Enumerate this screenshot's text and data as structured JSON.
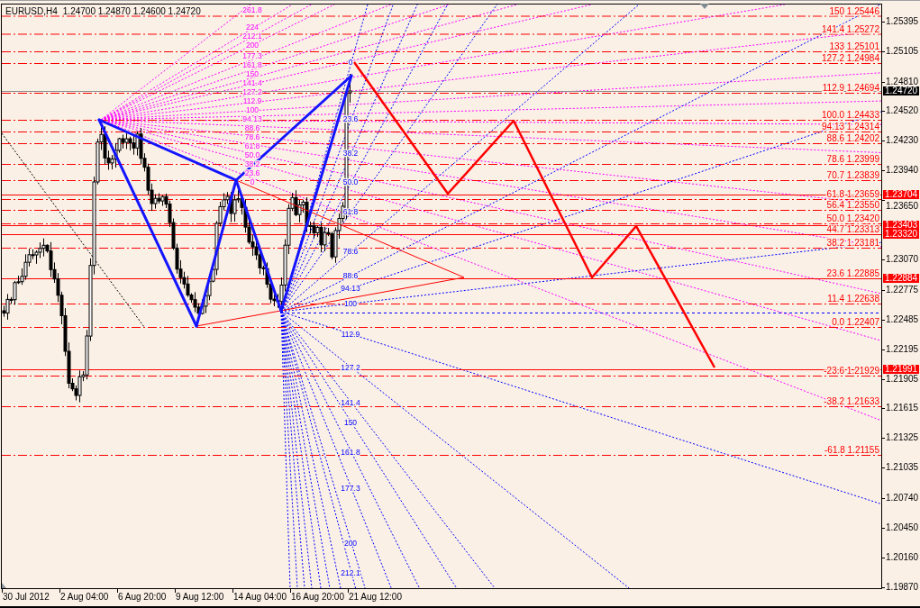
{
  "chart": {
    "symbol": "EURUSD,H4",
    "ohlc": "1.24700 1.24870 1.24600 1.24720"
  },
  "fib_levels": [
    "150 1.25446",
    "141.4 1.25272",
    "133 1.25101",
    "127.2 1.24984",
    "112.9 1.24694",
    "100.0 1.24433",
    "94.13 1.24314",
    "88.6 1.24202",
    "78.6 1.23999",
    "70.7 1.23839",
    "61.8 1.23659",
    "56.4 1.23550",
    "50.0 1.23420",
    "44.7 1.23313",
    "38.2 1.23181",
    "23.6 1.22885",
    "11.4 1.22638",
    "0.0 1.22407",
    "-23.6 1.21929",
    "-38.2 1.21633",
    "-61.8 1.21155"
  ],
  "fibonacci_fans": [
    {
      "color": "#ff00ff",
      "labels": [
        "261.8",
        "224",
        "212.1",
        "200",
        "177.3",
        "161.8",
        "150",
        "141.4",
        "127.2",
        "112.9",
        "100",
        "94.13",
        "88.6",
        "78.6",
        "61.8",
        "50.0",
        "38.2",
        "23.6",
        "0"
      ]
    },
    {
      "color": "#0000ff",
      "labels": [
        "0",
        "23.6",
        "38.2",
        "50.0",
        "61.8",
        "78.6",
        "88.6",
        "94.13",
        "100",
        "112.9",
        "127.2",
        "141.4",
        "150",
        "161.8",
        "177.3",
        "200",
        "212.1"
      ]
    }
  ],
  "price_axis": {
    "ticks": [
      "1.25395",
      "1.25105",
      "1.24810",
      "1.24520",
      "1.24230",
      "1.23940",
      "1.23650",
      "1.23070",
      "1.22775",
      "1.22485",
      "1.22195",
      "1.21905",
      "1.21615",
      "1.21325",
      "1.21035",
      "1.20740",
      "1.20450",
      "1.20160",
      "1.19870"
    ]
  },
  "price_tags": [
    {
      "kind": "bid",
      "text": "1.24720"
    },
    {
      "kind": "line",
      "text": "1.23704"
    },
    {
      "kind": "line",
      "text": "1.23403"
    },
    {
      "kind": "line",
      "text": "1.23320"
    },
    {
      "kind": "line",
      "text": "1.22884"
    },
    {
      "kind": "line",
      "text": "1.21991"
    }
  ],
  "time_axis": {
    "labels": [
      "30 Jul 2012",
      "2 Aug 04:00",
      "6 Aug 20:00",
      "9 Aug 12:00",
      "14 Aug 04:00",
      "16 Aug 20:00",
      "21 Aug 12:00"
    ]
  }
}
